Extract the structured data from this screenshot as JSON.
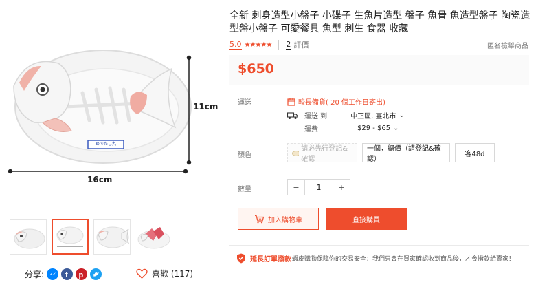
{
  "product": {
    "title": "全新 刺身造型小盤子 小碟子 生魚片造型 盤子 魚骨 魚造型盤子 陶瓷造型盤小盤子 可愛餐具 魚型 刺生 食器 收藏",
    "rating_value": "5.0",
    "review_count": "2",
    "review_label": "評價",
    "report_label": "匿名檢舉商品",
    "price": "$650"
  },
  "image": {
    "dim_width": "16cm",
    "dim_height": "11cm",
    "label_text": "めでたし丸"
  },
  "shipping": {
    "label": "運送",
    "early_label": "較長備貨( 20 個工作日寄出)",
    "ship_to_label": "運送 到",
    "location": "中正區, 臺北市",
    "fee_label": "運費",
    "fee": "$29 - $65"
  },
  "variants": {
    "label": "顏色",
    "options": [
      {
        "label": "請必先行登記&確認"
      },
      {
        "label": "一個，總價（請登記&確認）"
      },
      {
        "label": "客48d"
      }
    ]
  },
  "quantity": {
    "label": "數量",
    "value": "1",
    "minus": "−",
    "plus": "+"
  },
  "actions": {
    "add_to_cart": "加入購物車",
    "buy_now": "直接購買"
  },
  "guarantee": {
    "title": "延長訂單撥款",
    "text": "蝦皮購物保障你的交易安全：我們只會在買家確認收到商品後，才會撥款給賣家！"
  },
  "social": {
    "share_label": "分享:",
    "like_label": "喜歡 (117)",
    "icons": [
      "messenger-icon",
      "facebook-icon",
      "pinterest-icon",
      "twitter-icon"
    ]
  },
  "colors": {
    "accent": "#ee4d2d",
    "messenger": "#0084ff",
    "facebook": "#3b5998",
    "pinterest": "#cb2027",
    "twitter": "#1da1f2"
  }
}
